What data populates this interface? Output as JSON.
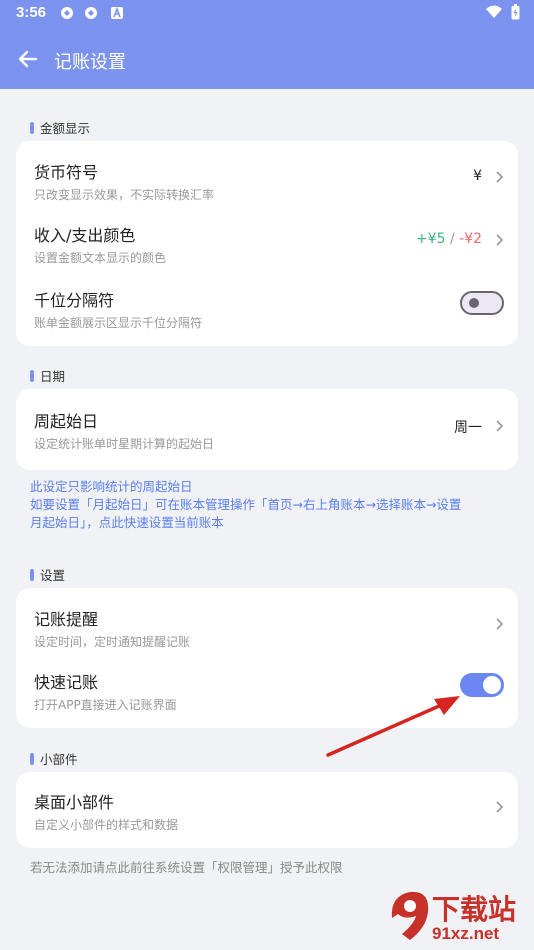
{
  "status": {
    "time": "3:56"
  },
  "header": {
    "title": "记账设置"
  },
  "sections": {
    "amount": {
      "title": "金额显示",
      "currency": {
        "label": "货币符号",
        "sub": "只改变显示效果，不实际转换汇率",
        "value": "¥"
      },
      "color": {
        "label": "收入/支出颜色",
        "sub": "设置金额文本显示的颜色",
        "income": "+¥5",
        "sep": " / ",
        "expense": "-¥2",
        "income_color": "#3fb37f",
        "expense_color": "#ef6a6a"
      },
      "thousands": {
        "label": "千位分隔符",
        "sub": "账单金额展示区显示千位分隔符",
        "enabled": false
      }
    },
    "date": {
      "title": "日期",
      "week_start": {
        "label": "周起始日",
        "sub": "设定统计账单时星期计算的起始日",
        "value": "周一"
      },
      "note_line1": "此设定只影响统计的周起始日",
      "note_line2": "如要设置「月起始日」可在账本管理操作「首页→右上角账本→选择账本→设置",
      "note_line3": "月起始日」，点此快速设置当前账本"
    },
    "settings": {
      "title": "设置",
      "reminder": {
        "label": "记账提醒",
        "sub": "设定时间，定时通知提醒记账"
      },
      "quick": {
        "label": "快速记账",
        "sub": "打开APP直接进入记账界面",
        "enabled": true
      }
    },
    "widget": {
      "title": "小部件",
      "desktop": {
        "label": "桌面小部件",
        "sub": "自定义小部件的样式和数据"
      },
      "note": "若无法添加请点此前往系统设置「权限管理」授予此权限"
    }
  },
  "watermark": {
    "text": "下载站",
    "url": "91xz.net"
  },
  "colors": {
    "accent": "#7b93ee",
    "toggle_on": "#6a86f0",
    "link": "#5b7ef2"
  }
}
